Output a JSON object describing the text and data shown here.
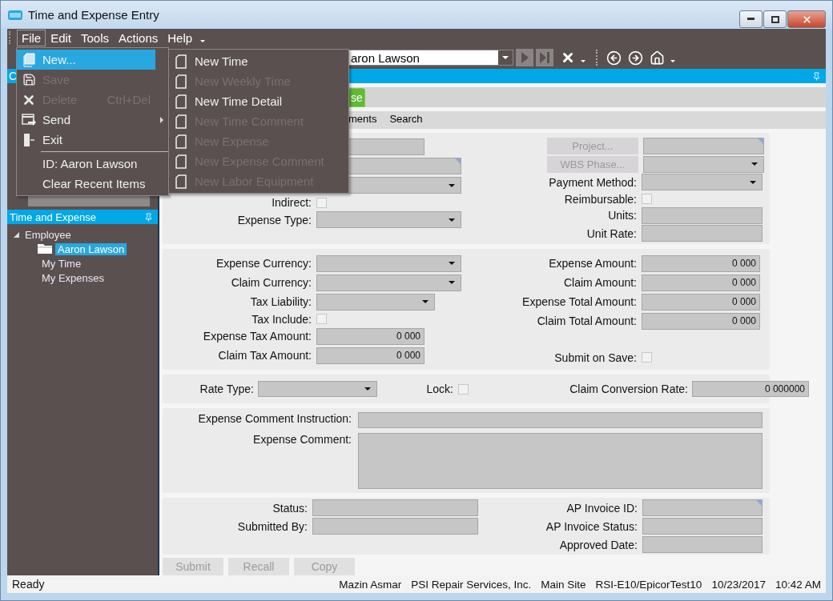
{
  "window": {
    "title": "Time and Expense Entry"
  },
  "menu_bar": [
    {
      "label": "File",
      "selected": true
    },
    {
      "label": "Edit",
      "selected": false
    },
    {
      "label": "Tools",
      "selected": false
    },
    {
      "label": "Actions",
      "selected": false
    },
    {
      "label": "Help",
      "selected": false
    }
  ],
  "file_menu": [
    {
      "label": "New...",
      "kind": "command",
      "selected": true,
      "disabled": false,
      "submenu": false
    },
    {
      "label": "Save",
      "kind": "command",
      "selected": false,
      "disabled": true,
      "submenu": false
    },
    {
      "label": "Delete",
      "kind": "command",
      "selected": false,
      "disabled": true,
      "submenu": false,
      "shortcut": "Ctrl+Del"
    },
    {
      "label": "Send",
      "kind": "command",
      "selected": false,
      "disabled": false,
      "submenu": true
    },
    {
      "label": "Exit",
      "kind": "command",
      "selected": false,
      "disabled": false,
      "submenu": false
    },
    {
      "label": "ID: Aaron Lawson",
      "kind": "recent",
      "selected": false,
      "disabled": false,
      "submenu": false
    },
    {
      "label": "Clear Recent Items",
      "kind": "recent",
      "selected": false,
      "disabled": false,
      "submenu": false
    }
  ],
  "new_submenu": [
    {
      "label": "New Time",
      "disabled": false
    },
    {
      "label": "New Weekly Time",
      "disabled": true
    },
    {
      "label": "New Time Detail",
      "disabled": false
    },
    {
      "label": "New Time Comment",
      "disabled": true
    },
    {
      "label": "New Expense",
      "disabled": true
    },
    {
      "label": "New Expense Comment",
      "disabled": true
    },
    {
      "label": "New Labor Equipment",
      "disabled": true
    }
  ],
  "toolbar": {
    "employee": {
      "value": "aron Lawson"
    }
  },
  "blue_bar": {
    "title": "C"
  },
  "tree_panel": {
    "title": "Time and Expense",
    "items": [
      {
        "label": "Employee",
        "kind": "node",
        "expanded": true,
        "selected": false,
        "children": [
          {
            "label": "Aaron Lawson",
            "kind": "folder",
            "selected": true
          },
          {
            "label": "My Time",
            "kind": "leaf",
            "selected": false
          },
          {
            "label": "My Expenses",
            "kind": "leaf",
            "selected": false
          }
        ]
      }
    ]
  },
  "tabs": [
    {
      "label": "se",
      "selected": true
    }
  ],
  "sub_tabs": [
    {
      "label": "ments",
      "selected": false
    },
    {
      "label": "Search",
      "selected": false
    }
  ],
  "sections": [
    {
      "kind": "two_column",
      "left": [
        {
          "kind": "text"
        },
        {
          "kind": "text",
          "lookup": true
        },
        {
          "kind": "combo"
        },
        {
          "label": "Indirect:",
          "kind": "check",
          "checked": false
        },
        {
          "label": "Expense Type:",
          "kind": "combo"
        }
      ],
      "right": [
        {
          "button": {
            "label": "Project...",
            "disabled": true
          },
          "kind": "text",
          "lookup": true
        },
        {
          "button": {
            "label": "WBS Phase...",
            "disabled": true
          },
          "kind": "combo"
        },
        {
          "label": "Payment Method:",
          "kind": "combo"
        },
        {
          "label": "Reimbursable:",
          "kind": "check",
          "checked": false
        },
        {
          "label": "Units:",
          "kind": "text"
        },
        {
          "label": "Unit Rate:",
          "kind": "text"
        }
      ]
    },
    {
      "kind": "two_column",
      "left": [
        {
          "label": "Expense Currency:",
          "kind": "combo"
        },
        {
          "label": "Claim Currency:",
          "kind": "combo"
        },
        {
          "label": "Tax Liability:",
          "kind": "combo"
        },
        {
          "label": "Tax Include:",
          "kind": "check",
          "checked": false
        },
        {
          "label": "Expense Tax Amount:",
          "kind": "text",
          "value": "0 000"
        },
        {
          "label": "Claim Tax Amount:",
          "kind": "text",
          "value": "0 000"
        }
      ],
      "right": [
        {
          "label": "Expense Amount:",
          "kind": "text",
          "value": "0 000"
        },
        {
          "label": "Claim Amount:",
          "kind": "text",
          "value": "0 000"
        },
        {
          "label": "Expense Total Amount:",
          "kind": "text",
          "value": "0 000"
        },
        {
          "label": "Claim Total Amount:",
          "kind": "text",
          "value": "0 000"
        },
        {
          "kind": "blank"
        },
        {
          "label": "Submit on Save:",
          "kind": "check",
          "checked": false
        }
      ]
    },
    {
      "kind": "inline",
      "fields": [
        {
          "label": "Rate Type:",
          "kind": "combo"
        },
        {
          "label": "Lock:",
          "kind": "check",
          "checked": false
        },
        {
          "label": "Claim Conversion Rate:",
          "kind": "text",
          "value": "0 000000"
        }
      ]
    },
    {
      "kind": "comment",
      "fields": [
        {
          "label": "Expense Comment Instruction:",
          "kind": "text"
        },
        {
          "label": "Expense Comment:",
          "kind": "memo"
        }
      ]
    },
    {
      "kind": "two_column",
      "left": [
        {
          "label": "Status:",
          "kind": "text"
        },
        {
          "label": "Submitted By:",
          "kind": "text"
        }
      ],
      "right": [
        {
          "label": "AP Invoice ID:",
          "kind": "text",
          "lookup": true
        },
        {
          "label": "AP Invoice Status:",
          "kind": "text"
        },
        {
          "label": "Approved Date:",
          "kind": "text"
        }
      ]
    }
  ],
  "actions": [
    {
      "label": "Submit",
      "disabled": true
    },
    {
      "label": "Recall",
      "disabled": true
    },
    {
      "label": "Copy",
      "disabled": true
    }
  ],
  "status_bar": {
    "message": "Ready",
    "items": [
      "Mazin Asmar",
      "PSI Repair Services, Inc.",
      "Main Site",
      "RSI-E10/EpicorTest10",
      "10/23/2017",
      "10:42 AM"
    ]
  }
}
